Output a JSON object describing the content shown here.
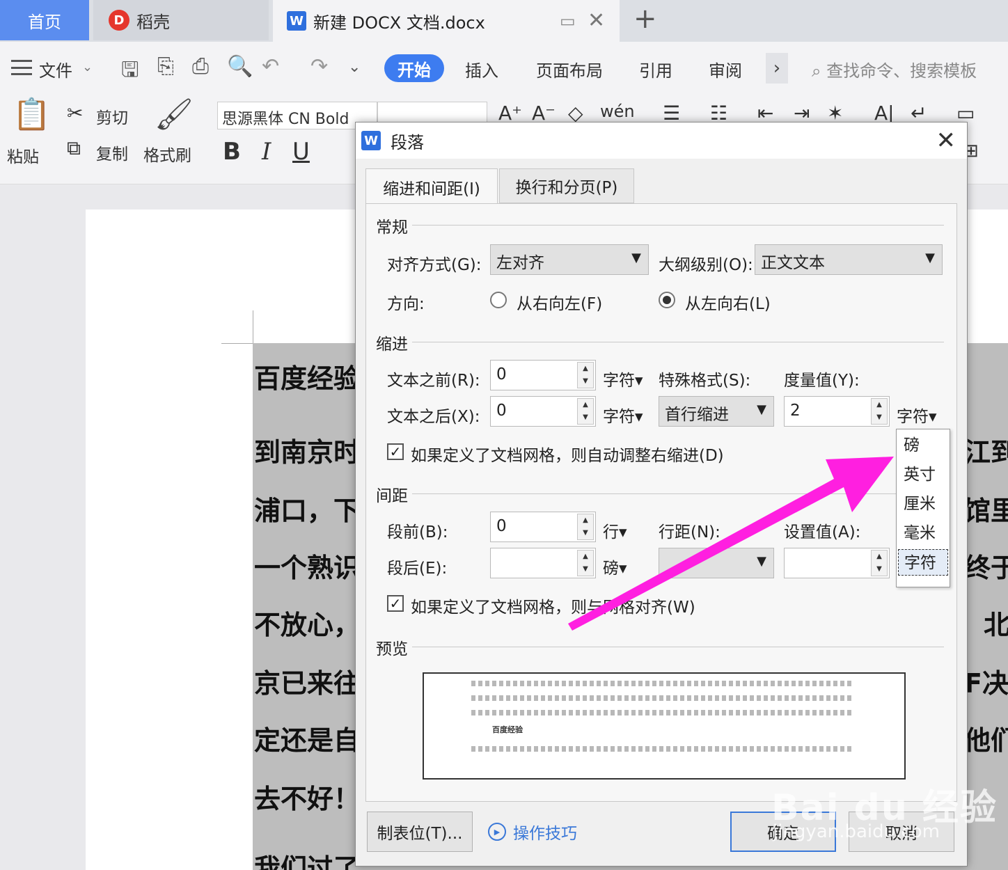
{
  "tabbar": {
    "home": "首页",
    "daoke": "稻壳",
    "doc_title": "新建 DOCX 文档.docx"
  },
  "menu": {
    "file": "文件",
    "start": "开始",
    "insert": "插入",
    "page_layout": "页面布局",
    "reference": "引用",
    "review": "审阅",
    "search_placeholder": "查找命令、搜索模板"
  },
  "toolbar": {
    "paste": "粘贴",
    "cut": "剪切",
    "copy": "复制",
    "format_painter": "格式刷",
    "font_name": "思源黑体 CN Bold",
    "bold": "B",
    "italic": "I",
    "underline": "U"
  },
  "document": {
    "left_lines": [
      "百度经验",
      "到南京时",
      "浦口，下",
      "一个熟识",
      "不放心，",
      "京已来往",
      "定还是自",
      "去不好！",
      "我们过了"
    ],
    "right_lines": [
      "江到",
      "馆里",
      "终于",
      "北",
      "F决",
      "他们"
    ]
  },
  "dialog": {
    "title": "段落",
    "tabs": [
      "缩进和间距(I)",
      "换行和分页(P)"
    ],
    "general": {
      "section": "常规",
      "align_label": "对齐方式(G):",
      "align_value": "左对齐",
      "outline_label": "大纲级别(O):",
      "outline_value": "正文文本",
      "direction_label": "方向:",
      "rtl": "从右向左(F)",
      "ltr": "从左向右(L)"
    },
    "indent": {
      "section": "缩进",
      "before_label": "文本之前(R):",
      "before_value": "0",
      "before_unit": "字符",
      "after_label": "文本之后(X):",
      "after_value": "0",
      "after_unit": "字符",
      "special_label": "特殊格式(S):",
      "special_value": "首行缩进",
      "measure_label": "度量值(Y):",
      "measure_value": "2",
      "measure_unit": "字符",
      "auto_adjust": "如果定义了文档网格，则自动调整右缩进(D)"
    },
    "spacing": {
      "section": "间距",
      "before_label": "段前(B):",
      "before_value": "0",
      "before_unit": "行",
      "after_label": "段后(E):",
      "after_value": "",
      "after_unit": "磅",
      "line_label": "行距(N):",
      "setting_label": "设置值(A):",
      "grid_align": "如果定义了文档网格，则与网格对齐(W)"
    },
    "preview": {
      "section": "预览",
      "sample_bold": "百度经验"
    },
    "buttons": {
      "tabs_stop": "制表位(T)...",
      "tips": "操作技巧",
      "ok": "确定",
      "cancel": "取消"
    }
  },
  "unit_dropdown": {
    "options": [
      "磅",
      "英寸",
      "厘米",
      "毫米",
      "字符"
    ],
    "selected": "字符"
  },
  "watermark": {
    "text": "Bai du 经验",
    "url": "jingyan.baidu.com"
  },
  "colors": {
    "accent": "#3d7cf0",
    "arrow": "#ff1fe0",
    "home_tab": "#5b8def"
  }
}
